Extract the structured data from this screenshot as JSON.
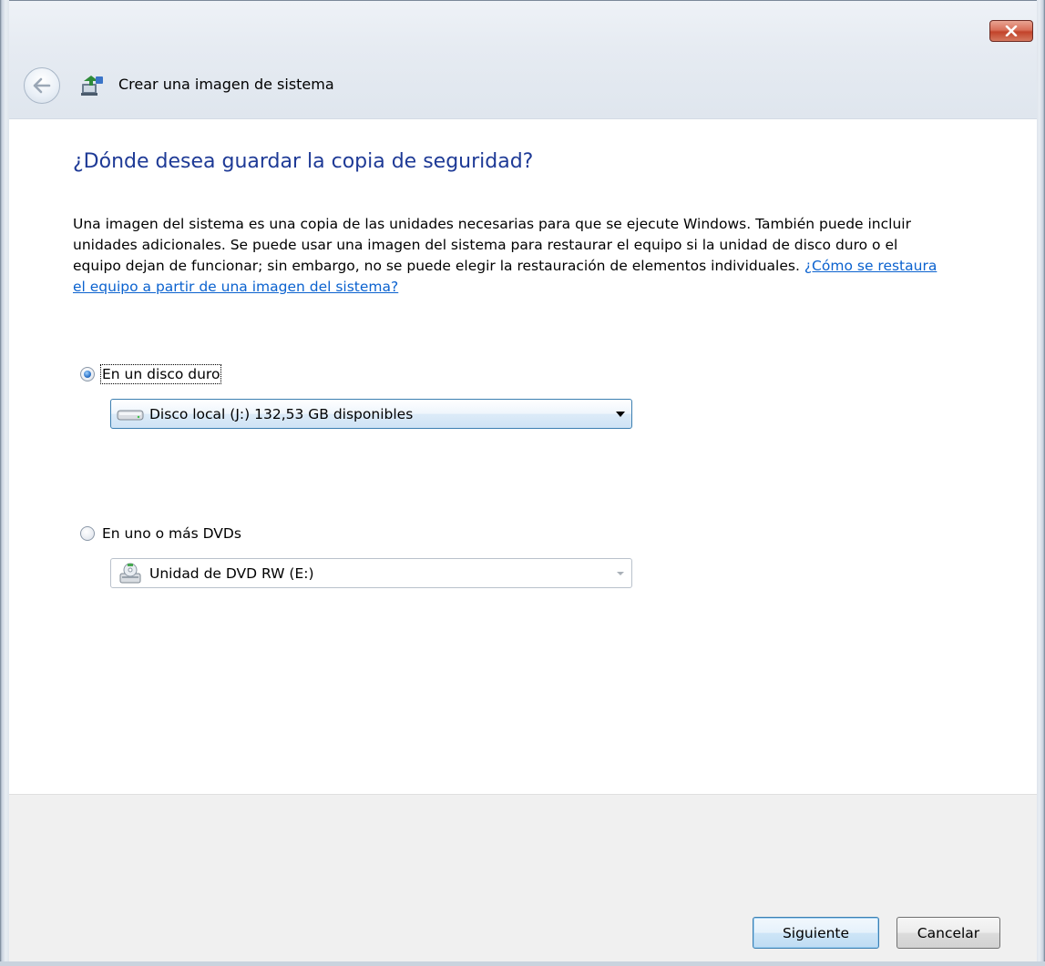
{
  "window": {
    "close_label": "x"
  },
  "nav": {
    "title": "Crear una imagen de sistema",
    "back_icon": "back-arrow-icon",
    "app_icon": "backup-icon"
  },
  "main": {
    "heading": "¿Dónde desea guardar la copia de seguridad?",
    "description": "Una imagen del sistema es una copia de las unidades necesarias para que se ejecute Windows. También puede incluir unidades adicionales. Se puede usar una imagen del sistema para restaurar el equipo si la unidad de disco duro o el equipo dejan de funcionar; sin embargo, no se puede elegir la restauración de elementos individuales. ",
    "help_link": "¿Cómo se restaura el equipo a partir de una imagen del sistema?",
    "options": [
      {
        "label": "En un disco duro",
        "selected": true,
        "dropdown_value": "Disco local (J:)  132,53 GB disponibles",
        "dropdown_icon": "hard-drive-icon"
      },
      {
        "label": "En uno o más DVDs",
        "selected": false,
        "dropdown_value": "Unidad de DVD RW (E:)",
        "dropdown_icon": "dvd-drive-icon"
      }
    ]
  },
  "footer": {
    "next_label": "Siguiente",
    "cancel_label": "Cancelar"
  },
  "colors": {
    "heading": "#1e3a96",
    "link": "#0b62cf",
    "accent_border": "#3c7fb1"
  }
}
